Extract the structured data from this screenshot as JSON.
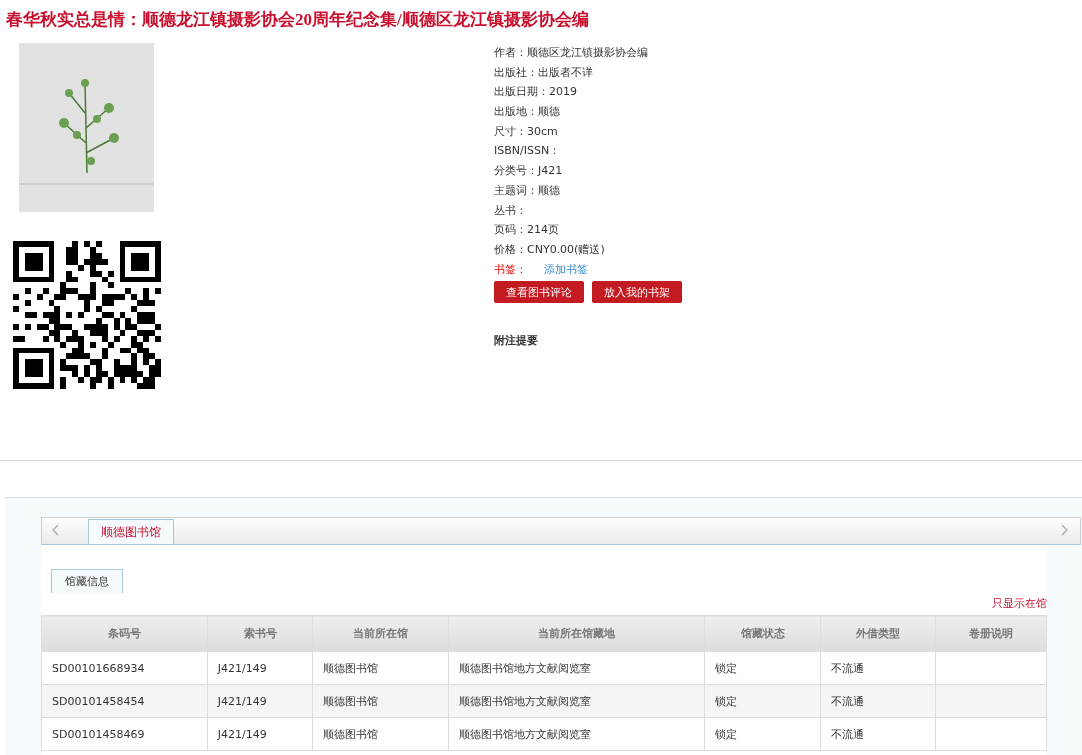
{
  "title": "春华秋实总是情：顺德龙江镇摄影协会20周年纪念集/顺德区龙江镇摄影协会编",
  "details": [
    {
      "label": "作者：",
      "value": "顺德区龙江镇摄影协会编"
    },
    {
      "label": "出版社：",
      "value": "出版者不详"
    },
    {
      "label": "出版日期：",
      "value": "2019"
    },
    {
      "label": "出版地：",
      "value": "顺德"
    },
    {
      "label": "尺寸：",
      "value": "30cm"
    },
    {
      "label": "ISBN/ISSN："
    },
    {
      "label": "分类号：",
      "value": "J421"
    },
    {
      "label": "主题词：",
      "value": "顺德"
    },
    {
      "label": "丛书："
    },
    {
      "label": "页码：",
      "value": "214页"
    },
    {
      "label": "价格：",
      "value": "CNY0.00(赠送)"
    }
  ],
  "bookmark": {
    "label": "书签：",
    "link": "添加书签"
  },
  "buttons": [
    "查看图书评论",
    "放入我的书架"
  ],
  "notes_heading": "附注提要",
  "library_tabs": [
    {
      "label": "顺德图书馆",
      "selected": true
    }
  ],
  "sub_tabs": [
    {
      "label": "馆藏信息",
      "selected": true
    }
  ],
  "filter_link": "只显示在馆",
  "table": {
    "columns": [
      "条码号",
      "索书号",
      "当前所在馆",
      "当前所在馆藏地",
      "馆藏状态",
      "外借类型",
      "卷册说明"
    ],
    "rows": [
      [
        "SD00101668934",
        "J421/149",
        "顺德图书馆",
        "顺德图书馆地方文献阅览室",
        "锁定",
        "不流通",
        null
      ],
      [
        "SD00101458454",
        "J421/149",
        "顺德图书馆",
        "顺德图书馆地方文献阅览室",
        "锁定",
        "不流通",
        null
      ],
      [
        "SD00101458469",
        "J421/149",
        "顺德图书馆",
        "顺德图书馆地方文献阅览室",
        "锁定",
        "不流通",
        null
      ]
    ]
  }
}
